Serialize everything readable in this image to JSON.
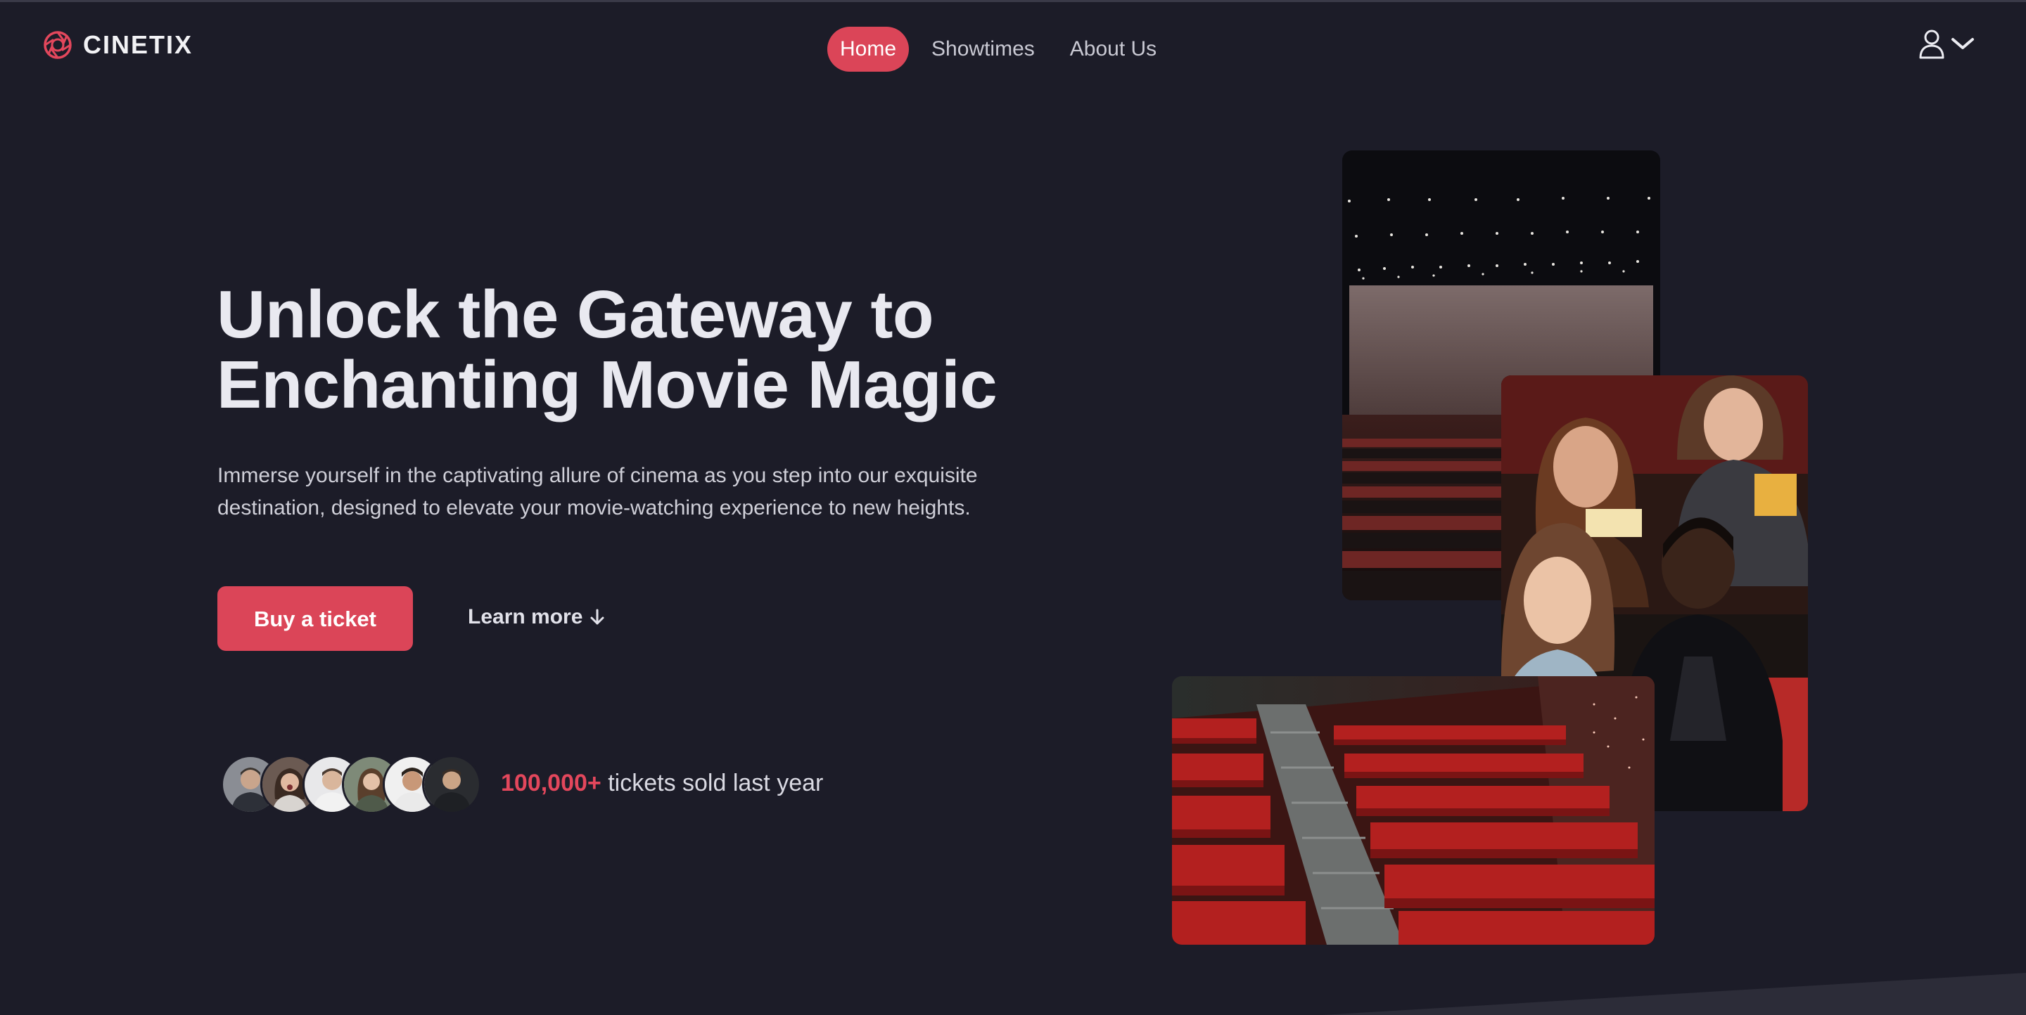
{
  "brand": {
    "name": "CINETIX"
  },
  "nav": {
    "items": [
      {
        "label": "Home",
        "active": true
      },
      {
        "label": "Showtimes",
        "active": false
      },
      {
        "label": "About Us",
        "active": false
      }
    ]
  },
  "account": {
    "icon": "user-icon",
    "chevron": "chevron-down-icon"
  },
  "hero": {
    "title_line1": "Unlock the Gateway to",
    "title_line2": "Enchanting Movie Magic",
    "subtitle_line1": "Immerse yourself in the captivating allure of cinema as you step into our exquisite",
    "subtitle_line2": "destination, designed to elevate your movie-watching experience to new heights.",
    "cta_primary": "Buy a ticket",
    "cta_secondary": "Learn more",
    "cta_secondary_icon": "arrow-down-icon"
  },
  "social_proof": {
    "count": "100,000+",
    "text": "tickets sold last year"
  },
  "colors": {
    "background": "#1c1c28",
    "accent": "#db4558",
    "text": "#e9e9f0"
  }
}
